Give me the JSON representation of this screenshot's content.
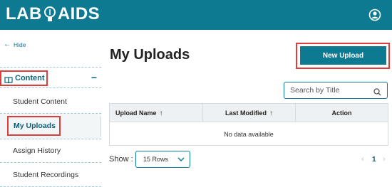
{
  "header": {
    "logo_left": "LAB",
    "logo_right": "AIDS",
    "accent_color": "#0d7a92"
  },
  "sidebar": {
    "hide_label": "Hide",
    "section_label": "Content",
    "collapse_symbol": "−",
    "items": [
      {
        "label": "Student Content"
      },
      {
        "label": "My Uploads",
        "selected": true
      },
      {
        "label": "Assign History"
      },
      {
        "label": "Student Recordings"
      }
    ]
  },
  "main": {
    "title": "My Uploads",
    "new_upload_label": "New Upload",
    "search_placeholder": "Search by Title",
    "table": {
      "columns": [
        {
          "label": "Upload Name",
          "sort": "↑"
        },
        {
          "label": "Last Modified",
          "sort": "↑"
        },
        {
          "label": "Action"
        }
      ],
      "empty_text": "No data available"
    },
    "pagination": {
      "show_label": "Show :",
      "rows_value": "15 Rows",
      "prev": "‹",
      "current_page": "1",
      "next": "›"
    }
  },
  "icons": [
    "lightbulb-icon",
    "user-account-icon",
    "arrow-left-icon",
    "book-icon",
    "search-icon",
    "chevron-down-icon"
  ]
}
